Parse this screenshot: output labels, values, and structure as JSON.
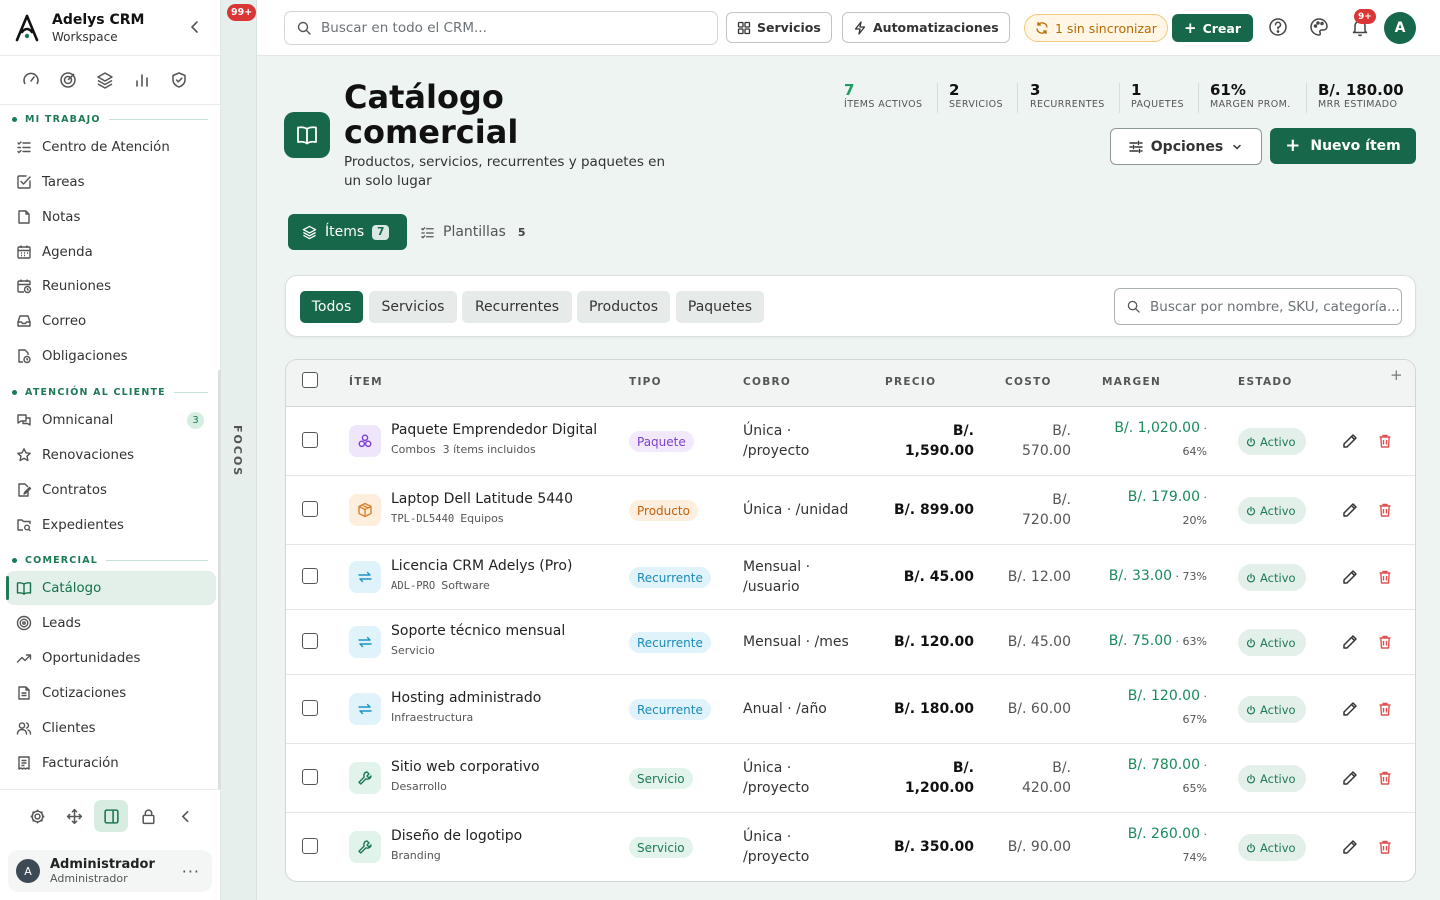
{
  "brand": {
    "name": "Adelys CRM",
    "workspace": "Workspace"
  },
  "sidebar": {
    "quick_icons": [
      "gauge-icon",
      "target-icon",
      "layers-icon",
      "bar-chart-icon",
      "shield-check-icon"
    ],
    "sections": [
      {
        "title": "MI TRABAJO",
        "items": [
          {
            "label": "Centro de Atención",
            "icon": "list-check-icon"
          },
          {
            "label": "Tareas",
            "icon": "checkbox-icon"
          },
          {
            "label": "Notas",
            "icon": "note-icon"
          },
          {
            "label": "Agenda",
            "icon": "calendar-icon"
          },
          {
            "label": "Reuniones",
            "icon": "calendar-clock-icon"
          },
          {
            "label": "Correo",
            "icon": "inbox-icon"
          },
          {
            "label": "Obligaciones",
            "icon": "file-clock-icon"
          }
        ]
      },
      {
        "title": "ATENCIÓN AL CLIENTE",
        "items": [
          {
            "label": "Omnicanal",
            "icon": "chat-icon",
            "count": "3"
          },
          {
            "label": "Renovaciones",
            "icon": "star-icon"
          },
          {
            "label": "Contratos",
            "icon": "file-signature-icon"
          },
          {
            "label": "Expedientes",
            "icon": "folder-search-icon"
          }
        ]
      },
      {
        "title": "COMERCIAL",
        "items": [
          {
            "label": "Catálogo",
            "icon": "book-open-icon",
            "active": true
          },
          {
            "label": "Leads",
            "icon": "target-icon"
          },
          {
            "label": "Oportunidades",
            "icon": "trending-up-icon"
          },
          {
            "label": "Cotizaciones",
            "icon": "file-text-icon"
          },
          {
            "label": "Clientes",
            "icon": "users-icon"
          },
          {
            "label": "Facturación",
            "icon": "receipt-icon"
          }
        ]
      }
    ],
    "bottom_tools": [
      "gear-icon",
      "move-icon",
      "panel-icon",
      "lock-icon",
      "chevron-left-icon"
    ],
    "user": {
      "initial": "A",
      "name": "Administrador",
      "role": "Administrador"
    }
  },
  "focos": {
    "label": "FOCOS",
    "badge": "99+"
  },
  "topbar": {
    "search_placeholder": "Buscar en todo el CRM...",
    "servicios": "Servicios",
    "automatizaciones": "Automatizaciones",
    "sync": "1 sin sincronizar",
    "create": "Crear",
    "notif_badge": "9+",
    "avatar": "A"
  },
  "header": {
    "title": "Catálogo comercial",
    "subtitle": "Productos, servicios, recurrentes y paquetes en un solo lugar",
    "stats": [
      {
        "value": "7",
        "label": "ÍTEMS ACTIVOS",
        "accent": true
      },
      {
        "value": "2",
        "label": "SERVICIOS"
      },
      {
        "value": "3",
        "label": "RECURRENTES"
      },
      {
        "value": "1",
        "label": "PAQUETES"
      },
      {
        "value": "61%",
        "label": "MARGEN PROM."
      },
      {
        "value": "B/. 180.00",
        "label": "MRR ESTIMADO"
      }
    ],
    "options": "Opciones",
    "new_item": "Nuevo ítem"
  },
  "tabs": [
    {
      "label": "Ítems",
      "count": "7",
      "active": true
    },
    {
      "label": "Plantillas",
      "count": "5"
    }
  ],
  "filters": {
    "chips": [
      "Todos",
      "Servicios",
      "Recurrentes",
      "Productos",
      "Paquetes"
    ],
    "active": "Todos",
    "search_placeholder": "Buscar por nombre, SKU, categoría..."
  },
  "table": {
    "columns": [
      "ÍTEM",
      "TIPO",
      "COBRO",
      "PRECIO",
      "COSTO",
      "MARGEN",
      "ESTADO"
    ],
    "rows": [
      {
        "name": "Paquete Emprendedor Digital",
        "sku": "",
        "category": "Combos",
        "extra": "3 ítems incluidos",
        "type": "Paquete",
        "cobro": "Única · /proyecto",
        "precio": "B/. 1,590.00",
        "costo": "B/. 570.00",
        "margen": "B/. 1,020.00",
        "margen_pct": "64%",
        "estado": "Activo"
      },
      {
        "name": "Laptop Dell Latitude 5440",
        "sku": "TPL-DL5440",
        "category": "Equipos",
        "type": "Producto",
        "cobro": "Única · /unidad",
        "precio": "B/. 899.00",
        "costo": "B/. 720.00",
        "margen": "B/. 179.00",
        "margen_pct": "20%",
        "estado": "Activo"
      },
      {
        "name": "Licencia CRM Adelys (Pro)",
        "sku": "ADL-PRO",
        "category": "Software",
        "type": "Recurrente",
        "cobro": "Mensual · /usuario",
        "precio": "B/. 45.00",
        "costo": "B/. 12.00",
        "margen": "B/. 33.00",
        "margen_pct": "73%",
        "estado": "Activo"
      },
      {
        "name": "Soporte técnico mensual",
        "sku": "",
        "category": "Servicio",
        "type": "Recurrente",
        "cobro": "Mensual · /mes",
        "precio": "B/. 120.00",
        "costo": "B/. 45.00",
        "margen": "B/. 75.00",
        "margen_pct": "63%",
        "estado": "Activo"
      },
      {
        "name": "Hosting administrado",
        "sku": "",
        "category": "Infraestructura",
        "type": "Recurrente",
        "cobro": "Anual · /año",
        "precio": "B/. 180.00",
        "costo": "B/. 60.00",
        "margen": "B/. 120.00",
        "margen_pct": "67%",
        "estado": "Activo"
      },
      {
        "name": "Sitio web corporativo",
        "sku": "",
        "category": "Desarrollo",
        "type": "Servicio",
        "cobro": "Única · /proyecto",
        "precio": "B/. 1,200.00",
        "costo": "B/. 420.00",
        "margen": "B/. 780.00",
        "margen_pct": "65%",
        "estado": "Activo"
      },
      {
        "name": "Diseño de logotipo",
        "sku": "",
        "category": "Branding",
        "type": "Servicio",
        "cobro": "Única · /proyecto",
        "precio": "B/. 350.00",
        "costo": "B/. 90.00",
        "margen": "B/. 260.00",
        "margen_pct": "74%",
        "estado": "Activo"
      }
    ]
  },
  "colors": {
    "primary": "#17684a",
    "accent": "#1d9b63",
    "danger": "#e05252"
  }
}
